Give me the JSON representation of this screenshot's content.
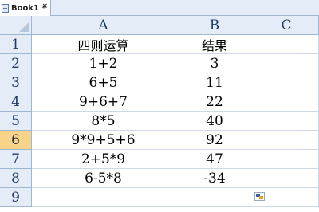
{
  "tab": {
    "title": "Book1 *",
    "close": "×"
  },
  "columns": [
    "A",
    "B",
    "C"
  ],
  "rows": [
    "1",
    "2",
    "3",
    "4",
    "5",
    "6",
    "7",
    "8",
    "9"
  ],
  "active_row": "6",
  "cells": [
    {
      "a": "四则运算",
      "b": "结果"
    },
    {
      "a": "1+2",
      "b": "3"
    },
    {
      "a": "6+5",
      "b": "11"
    },
    {
      "a": "9+6+7",
      "b": "22"
    },
    {
      "a": "8*5",
      "b": "40"
    },
    {
      "a": "9*9+5+6",
      "b": "92"
    },
    {
      "a": "2+5*9",
      "b": "47"
    },
    {
      "a": "6-5*8",
      "b": "-34"
    },
    {
      "a": "",
      "b": ""
    }
  ],
  "icons": {
    "workbook": "workbook-icon",
    "paste_options": "paste-options-icon"
  },
  "colors": {
    "header_bg": "#e4ecf7",
    "active_header": "#f8d48a",
    "gridline": "#d0d7e5"
  }
}
